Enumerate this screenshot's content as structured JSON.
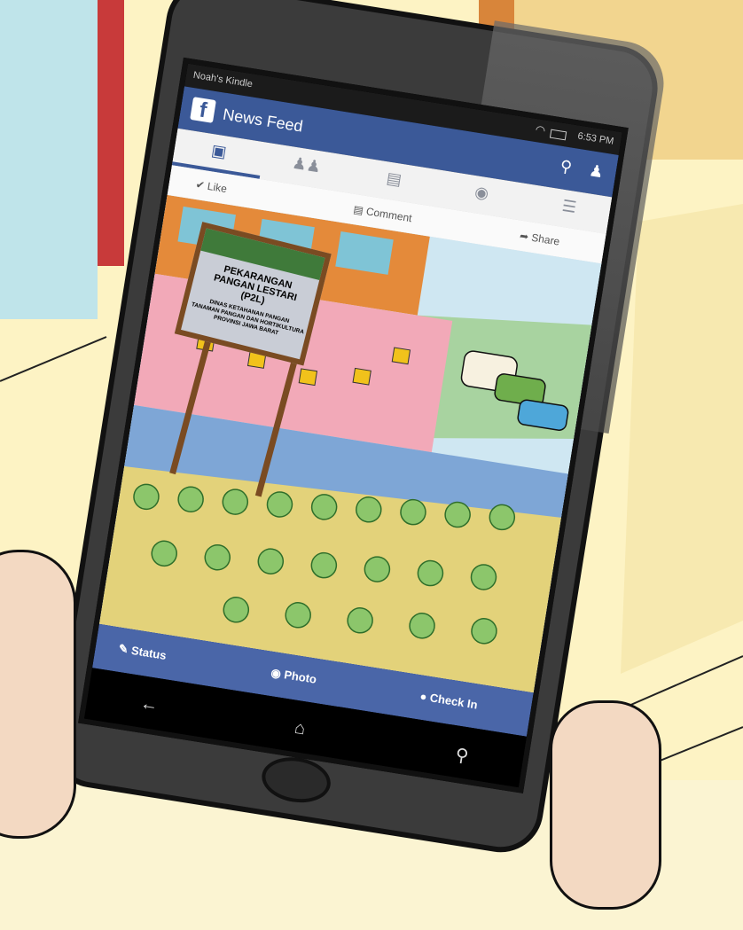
{
  "status_bar": {
    "device_owner": "Noah's Kindle",
    "time": "6:53 PM"
  },
  "header": {
    "logo": "f",
    "title": "News Feed"
  },
  "tabs": [
    {
      "icon": "news-feed-icon"
    },
    {
      "icon": "friends-icon"
    },
    {
      "icon": "messages-icon"
    },
    {
      "icon": "globe-icon"
    },
    {
      "icon": "menu-icon"
    }
  ],
  "post_actions": {
    "like": "Like",
    "comment": "Comment",
    "share": "Share"
  },
  "feed_image": {
    "sign_title_1": "PEKARANGAN",
    "sign_title_2": "PANGAN LESTARI",
    "sign_title_3": "(P2L)",
    "sign_sub_1": "DINAS KETAHANAN PANGAN",
    "sign_sub_2": "TANAMAN PANGAN DAN HORTIKULTURA",
    "sign_sub_3": "PROVINSI JAWA BARAT"
  },
  "composer": {
    "status": "Status",
    "photo": "Photo",
    "checkin": "Check In"
  },
  "colors": {
    "facebook_blue": "#3b5998",
    "composer_blue": "#4a66a8"
  }
}
